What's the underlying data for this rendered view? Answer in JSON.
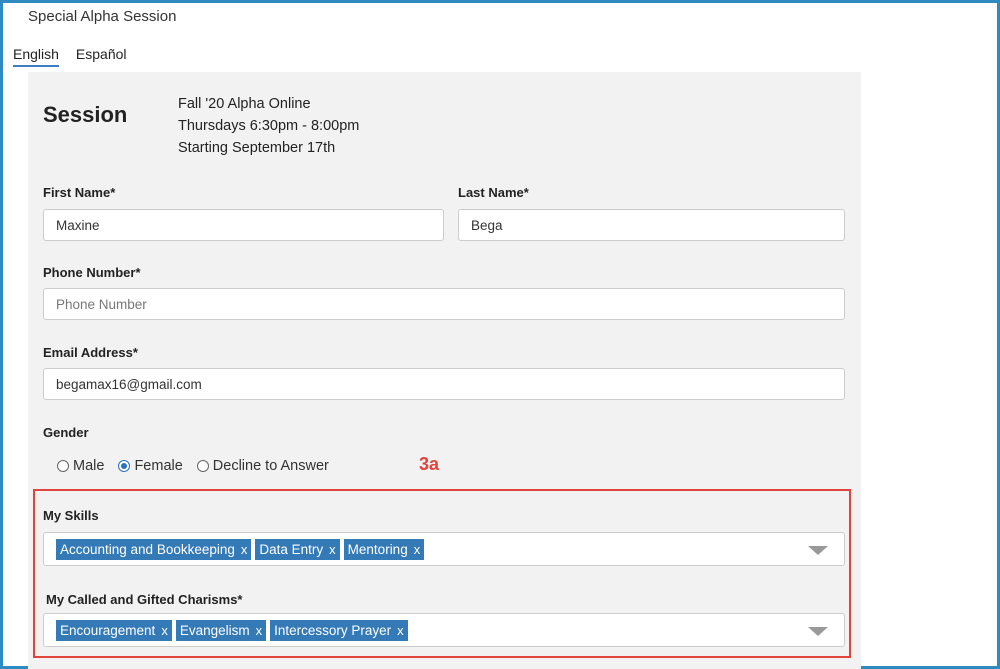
{
  "app_title": "Special Alpha Session",
  "languages": [
    {
      "label": "English",
      "active": true
    },
    {
      "label": "Español",
      "active": false
    }
  ],
  "session": {
    "heading": "Session",
    "lines": [
      "Fall '20 Alpha Online",
      "Thursdays 6:30pm - 8:00pm",
      "Starting September 17th"
    ]
  },
  "form": {
    "first_name": {
      "label": "First Name*",
      "value": "Maxine"
    },
    "last_name": {
      "label": "Last Name*",
      "value": "Bega"
    },
    "phone": {
      "label": "Phone Number*",
      "value": "",
      "placeholder": "Phone Number"
    },
    "email": {
      "label": "Email Address*",
      "value": "begamax16@gmail.com"
    },
    "gender": {
      "label": "Gender",
      "options": [
        "Male",
        "Female",
        "Decline to Answer"
      ],
      "selected": "Female"
    },
    "skills": {
      "label": "My Skills",
      "tags": [
        "Accounting and Bookkeeping",
        "Data Entry",
        "Mentoring"
      ]
    },
    "charisms": {
      "label": "My Called and Gifted Charisms*",
      "tags": [
        "Encouragement",
        "Evangelism",
        "Intercessory Prayer"
      ]
    },
    "tag_remove_glyph": "x"
  },
  "annotation": "3a",
  "colors": {
    "frame": "#2e8bc0",
    "tag_bg": "#337ab7",
    "highlight": "#e0443c",
    "panel": "#f2f2f2"
  }
}
